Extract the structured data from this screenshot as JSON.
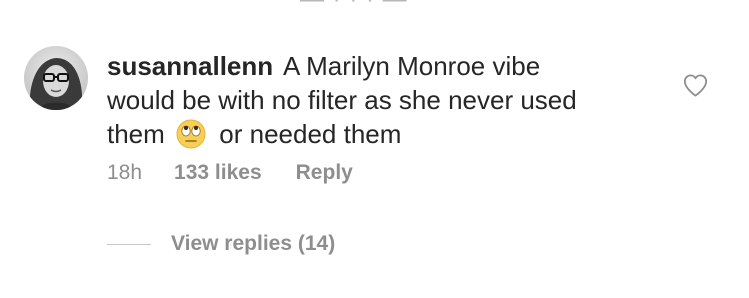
{
  "comment": {
    "username": "susannallenn",
    "text_line1": "A Marilyn Monroe vibe",
    "text_line2": "would be with no filter as she never used",
    "text_before_emoji": "them",
    "text_after_emoji": "or needed them",
    "emoji_icon": "rolling-eyes-emoji"
  },
  "meta": {
    "time": "18h",
    "likes": "133 likes",
    "reply_label": "Reply"
  },
  "replies": {
    "label": "View replies (14)"
  },
  "colors": {
    "text": "#262626",
    "secondary": "#8e8e8e",
    "divider": "#c7c7c7"
  }
}
